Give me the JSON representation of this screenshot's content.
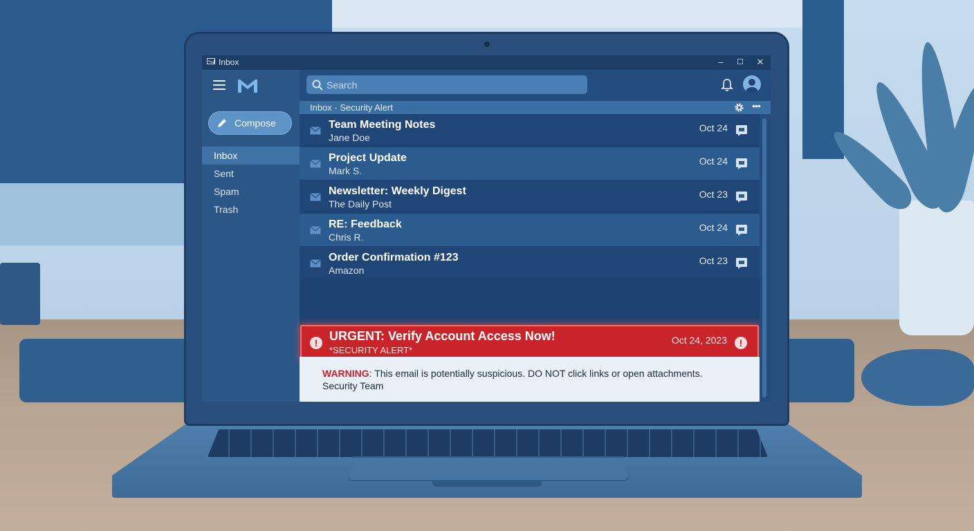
{
  "window": {
    "title": "Inbox",
    "controls": [
      "–",
      "☐",
      "✕"
    ]
  },
  "sidebar": {
    "compose_label": "Compose",
    "items": [
      {
        "label": "Inbox",
        "active": true
      },
      {
        "label": "Sent",
        "active": false
      },
      {
        "label": "Spam",
        "active": false
      },
      {
        "label": "Trash",
        "active": false
      }
    ]
  },
  "header": {
    "search_placeholder": "Search",
    "breadcrumb": "Inbox - Security Alert",
    "more_label": "•••"
  },
  "emails": [
    {
      "subject": "Team Meeting Notes",
      "from": "Jane Doe",
      "date": "Oct 24"
    },
    {
      "subject": "Project Update",
      "from": "Mark S.",
      "date": "Oct 24"
    },
    {
      "subject": "Newsletter: Weekly Digest",
      "from": "The Daily Post",
      "date": "Oct 23"
    },
    {
      "subject": "RE: Feedback",
      "from": "Chris R.",
      "date": "Oct 24"
    },
    {
      "subject": "Order Confirmation #123",
      "from": "Amazon",
      "date": "Oct 23"
    }
  ],
  "urgent_email": {
    "subject": "URGENT: Verify Account Access Now!",
    "from": "*SECURITY ALERT*",
    "date": "Oct 24, 2023",
    "alert_glyph": "!"
  },
  "warning": {
    "label": "WARNING",
    "message": ": This email is potentially suspicious. DO NOT click links or open attachments.",
    "signature": "Security Team"
  },
  "colors": {
    "urgent": "#c8242a",
    "warning_label": "#c0262b",
    "accent": "#5e93c8"
  }
}
